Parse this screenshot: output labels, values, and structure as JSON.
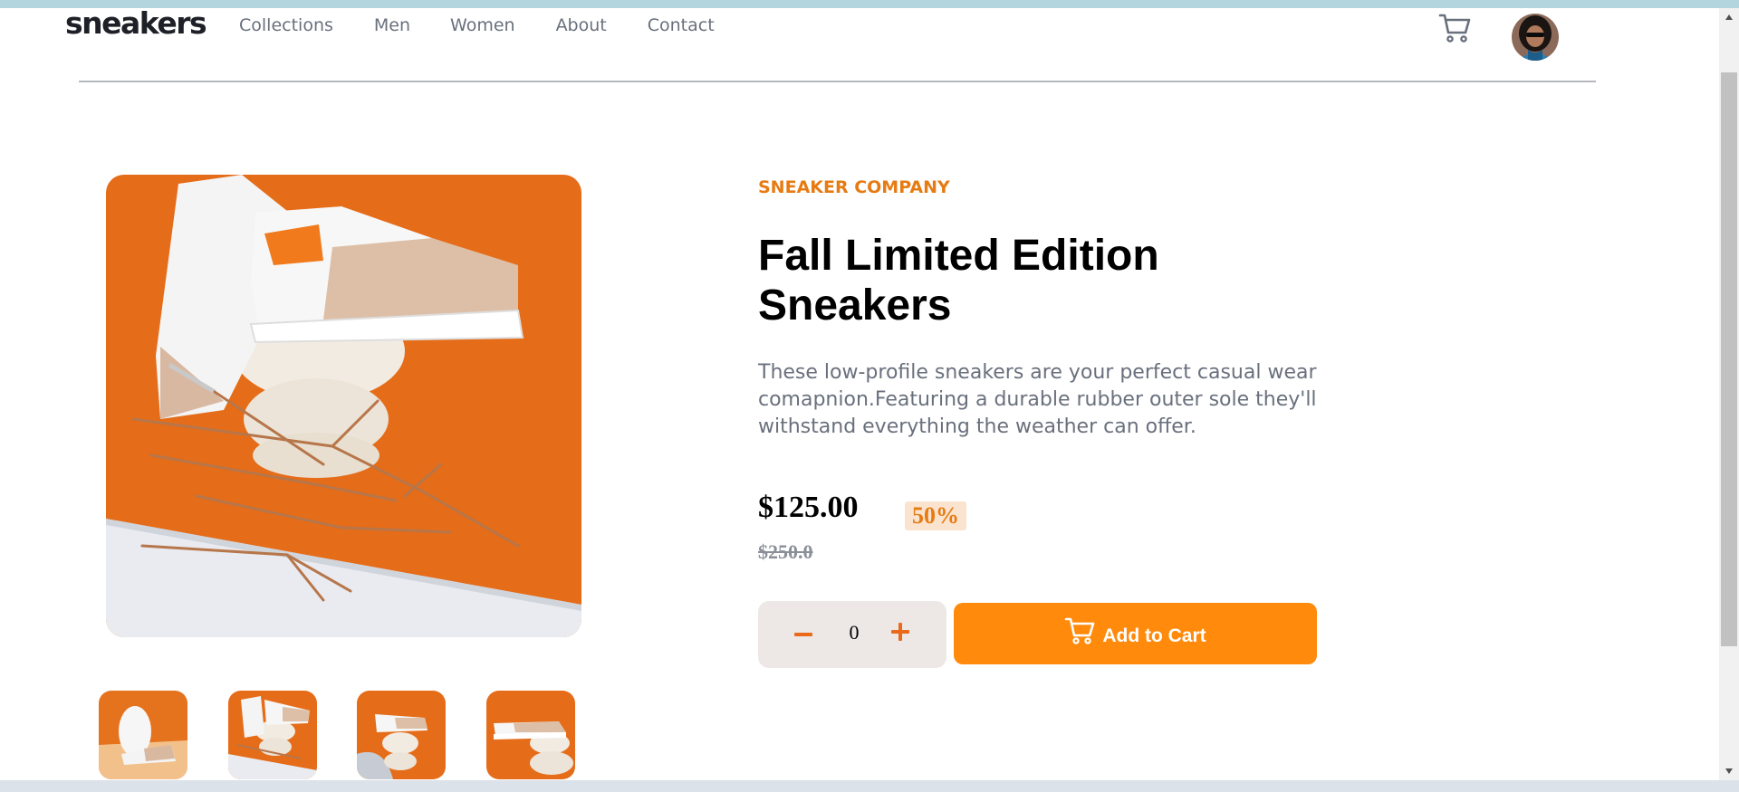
{
  "header": {
    "logo": "sneakers",
    "nav": [
      "Collections",
      "Men",
      "Women",
      "About",
      "Contact"
    ],
    "cart_icon": "cart-icon",
    "avatar_icon": "user-avatar"
  },
  "product": {
    "company": "SNEAKER COMPANY",
    "title": "Fall Limited Edition Sneakers",
    "description": "These low-profile sneakers are your perfect casual wear comapnion.Featuring a durable rubber outer sole they'll withstand everything the weather can offer.",
    "price": "$125.00",
    "discount": "50%",
    "old_price": "$250.0",
    "quantity": "0",
    "add_to_cart": "Add to Cart"
  },
  "gallery": {
    "thumbnail_count": 4
  },
  "colors": {
    "accent": "#ff8a0c",
    "accent_text": "#e77b13",
    "pale_orange": "#fae3cf",
    "dark_text": "#1d2026",
    "gray_text": "#69707d"
  }
}
